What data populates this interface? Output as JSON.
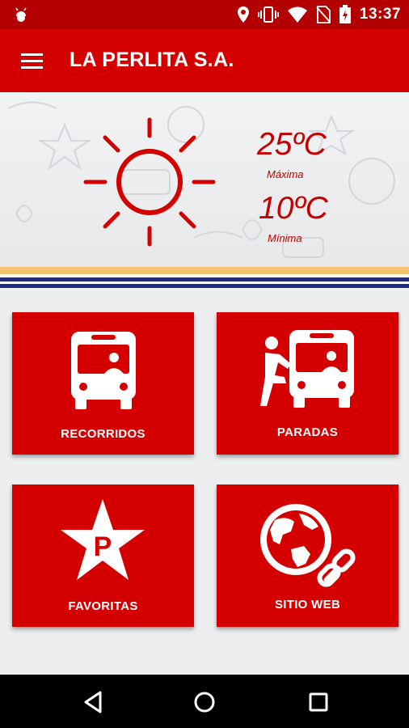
{
  "status_bar": {
    "time": "13:37",
    "icons": [
      "android-icon",
      "location-icon",
      "vibrate-icon",
      "wifi-icon",
      "no-sim-icon",
      "battery-icon"
    ]
  },
  "app_bar": {
    "title": "LA PERLITA S.A.",
    "menu_icon": "hamburger-menu-icon"
  },
  "weather": {
    "icon": "sun-icon",
    "max_temp": "25ºC",
    "max_label": "Máxima",
    "min_temp": "10ºC",
    "min_label": "Mínima"
  },
  "tiles": [
    {
      "label": "RECORRIDOS",
      "icon": "bus-icon"
    },
    {
      "label": "PARADAS",
      "icon": "bus-stop-icon"
    },
    {
      "label": "FAVORITAS",
      "icon": "star-p-icon"
    },
    {
      "label": "SITIO WEB",
      "icon": "globe-link-icon"
    }
  ],
  "nav_bar": {
    "back": "back-icon",
    "home": "home-icon",
    "recents": "recents-icon"
  },
  "colors": {
    "primary": "#d40000",
    "status_bar": "#b30000",
    "stripe_gold": "#f2c36b",
    "stripe_blue": "#1e2a84"
  }
}
